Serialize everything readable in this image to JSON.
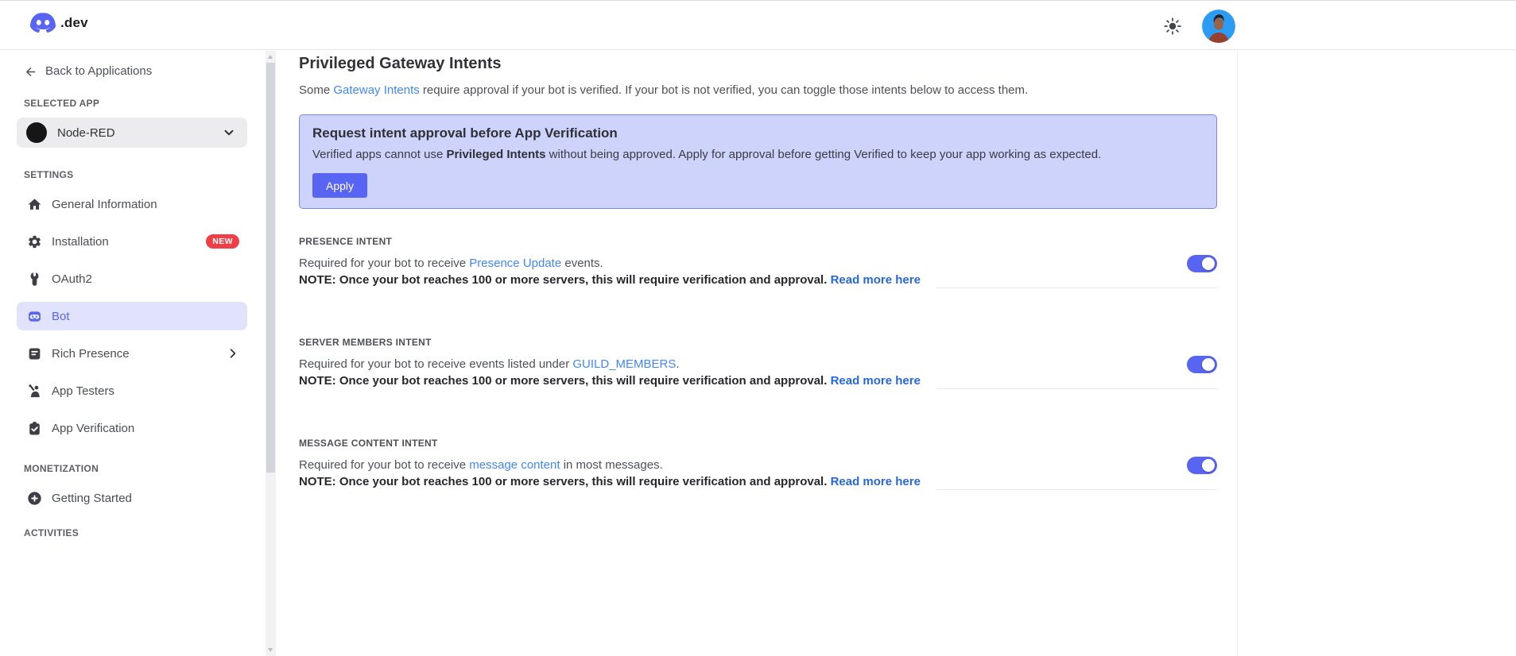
{
  "header": {
    "logo_suffix": ".dev",
    "theme_toggle": "light-theme",
    "avatar": "user-avatar"
  },
  "sidebar": {
    "back_link": "Back to Applications",
    "selected_app_label": "SELECTED APP",
    "app_selector": {
      "name": "Node-RED"
    },
    "sections": [
      {
        "heading": "SETTINGS",
        "items": [
          {
            "label": "General Information",
            "icon": "home-icon"
          },
          {
            "label": "Installation",
            "icon": "gear-icon",
            "badge": "NEW"
          },
          {
            "label": "OAuth2",
            "icon": "wrench-icon"
          },
          {
            "label": "Bot",
            "icon": "bot-icon",
            "active": true
          },
          {
            "label": "Rich Presence",
            "icon": "pages-icon",
            "chevron": true
          },
          {
            "label": "App Testers",
            "icon": "wave-person-icon"
          },
          {
            "label": "App Verification",
            "icon": "clipboard-check-icon"
          }
        ]
      },
      {
        "heading": "MONETIZATION",
        "items": [
          {
            "label": "Getting Started",
            "icon": "plus-circle-icon"
          }
        ]
      },
      {
        "heading": "ACTIVITIES",
        "items": []
      }
    ]
  },
  "main": {
    "title": "Privileged Gateway Intents",
    "intro": {
      "pre": "Some ",
      "link": "Gateway Intents",
      "post": " require approval if your bot is verified. If your bot is not verified, you can toggle those intents below to access them."
    },
    "callout": {
      "title": "Request intent approval before App Verification",
      "body_pre": "Verified apps cannot use ",
      "body_bold": "Privileged Intents",
      "body_post": " without being approved. Apply for approval before getting Verified to keep your app working as expected.",
      "button": "Apply"
    },
    "intents": [
      {
        "label": "PRESENCE INTENT",
        "desc_pre": "Required for your bot to receive ",
        "desc_link": "Presence Update",
        "desc_post": " events.",
        "note": "NOTE: Once your bot reaches 100 or more servers, this will require verification and approval. ",
        "read_more": "Read more here",
        "enabled": true
      },
      {
        "label": "SERVER MEMBERS INTENT",
        "desc_pre": "Required for your bot to receive events listed under ",
        "desc_link": "GUILD_MEMBERS",
        "desc_post": ".",
        "note": "NOTE: Once your bot reaches 100 or more servers, this will require verification and approval. ",
        "read_more": "Read more here",
        "enabled": true
      },
      {
        "label": "MESSAGE CONTENT INTENT",
        "desc_pre": "Required for your bot to receive ",
        "desc_link": "message content",
        "desc_post": " in most messages.",
        "note": "NOTE: Once your bot reaches 100 or more servers, this will require verification and approval. ",
        "read_more": "Read more here",
        "enabled": true
      }
    ]
  },
  "colors": {
    "blurple": "#5865f2",
    "callout_bg": "#cdd3fa",
    "callout_border": "#7a85f1",
    "link": "#4287f5",
    "link_strong": "#2667e0",
    "badge_red": "#f03e47",
    "active_item_bg": "#e1e3fd"
  }
}
